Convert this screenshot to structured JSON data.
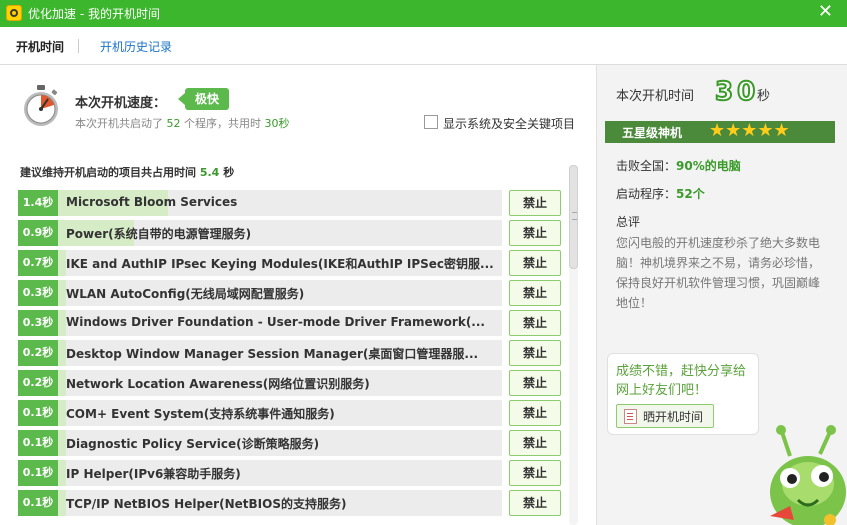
{
  "window": {
    "title": "优化加速 - 我的开机时间",
    "close_glyph": "✕"
  },
  "tabs": [
    {
      "label": "开机时间",
      "active": true
    },
    {
      "label": "开机历史记录",
      "active": false
    }
  ],
  "speed": {
    "label": "本次开机速度：",
    "badge": "极快",
    "summary_prefix": "本次开机共启动了",
    "program_count": "52",
    "summary_mid": "个程序，共用时",
    "total_time": "30秒"
  },
  "toggle": {
    "label": "显示系统及安全关键项目",
    "checked": false
  },
  "recommend": {
    "prefix": "建议维持开机启动的项目共占用时间",
    "time": "5.4",
    "unit": "秒"
  },
  "startup_items": [
    {
      "time": "1.4秒",
      "name": "Microsoft Bloom Services",
      "fill": 0.31,
      "button": "禁止"
    },
    {
      "time": "0.9秒",
      "name": "Power(系统自带的电源管理服务)",
      "fill": 0.24,
      "button": "禁止"
    },
    {
      "time": "0.7秒",
      "name": "IKE and AuthIP IPsec Keying Modules(IKE和AuthIP IPSec密钥服...",
      "fill": 0.1,
      "button": "禁止"
    },
    {
      "time": "0.3秒",
      "name": "WLAN AutoConfig(无线局域网配置服务)",
      "fill": 0.1,
      "button": "禁止"
    },
    {
      "time": "0.3秒",
      "name": "Windows Driver Foundation - User-mode Driver Framework(...",
      "fill": 0.1,
      "button": "禁止"
    },
    {
      "time": "0.2秒",
      "name": "Desktop Window Manager Session Manager(桌面窗口管理器服...",
      "fill": 0.1,
      "button": "禁止"
    },
    {
      "time": "0.2秒",
      "name": "Network Location Awareness(网络位置识别服务)",
      "fill": 0.1,
      "button": "禁止"
    },
    {
      "time": "0.1秒",
      "name": "COM+ Event System(支持系统事件通知服务)",
      "fill": 0.1,
      "button": "禁止"
    },
    {
      "time": "0.1秒",
      "name": "Diagnostic Policy Service(诊断策略服务)",
      "fill": 0.1,
      "button": "禁止"
    },
    {
      "time": "0.1秒",
      "name": "IP Helper(IPv6兼容助手服务)",
      "fill": 0.1,
      "button": "禁止"
    },
    {
      "time": "0.1秒",
      "name": "TCP/IP NetBIOS Helper(NetBIOS的支持服务)",
      "fill": 0.1,
      "button": "禁止"
    }
  ],
  "sidebar": {
    "time_label": "本次开机时间",
    "time_value": "30",
    "time_unit": "秒",
    "rank_label": "五星级神机",
    "stars": "★★★★★",
    "beat_label": "击败全国：",
    "beat_value": "90%的电脑",
    "startup_label": "启动程序：",
    "startup_value": "52个",
    "comment_title": "总评",
    "comment_text": "您闪电般的开机速度秒杀了绝大多数电脑！神机境界来之不易，请务必珍惜，保持良好开机软件管理习惯，巩固巅峰地位！",
    "share_text": "成绩不错，赶快分享给网上好友们吧！",
    "share_button": "晒开机时间"
  },
  "colors": {
    "titlebar": "#3cb62c",
    "accent_green": "#5cb94b",
    "rank_bar": "#4a8a3a",
    "star": "#ffcc1a"
  }
}
